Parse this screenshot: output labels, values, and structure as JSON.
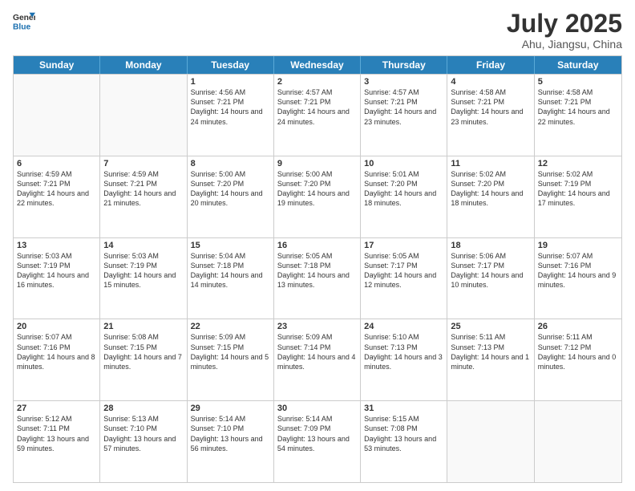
{
  "header": {
    "logo_line1": "General",
    "logo_line2": "Blue",
    "month_year": "July 2025",
    "location": "Ahu, Jiangsu, China"
  },
  "weekdays": [
    "Sunday",
    "Monday",
    "Tuesday",
    "Wednesday",
    "Thursday",
    "Friday",
    "Saturday"
  ],
  "weeks": [
    [
      {
        "day": "",
        "info": "",
        "empty": true
      },
      {
        "day": "",
        "info": "",
        "empty": true
      },
      {
        "day": "1",
        "info": "Sunrise: 4:56 AM\nSunset: 7:21 PM\nDaylight: 14 hours and 24 minutes."
      },
      {
        "day": "2",
        "info": "Sunrise: 4:57 AM\nSunset: 7:21 PM\nDaylight: 14 hours and 24 minutes."
      },
      {
        "day": "3",
        "info": "Sunrise: 4:57 AM\nSunset: 7:21 PM\nDaylight: 14 hours and 23 minutes."
      },
      {
        "day": "4",
        "info": "Sunrise: 4:58 AM\nSunset: 7:21 PM\nDaylight: 14 hours and 23 minutes."
      },
      {
        "day": "5",
        "info": "Sunrise: 4:58 AM\nSunset: 7:21 PM\nDaylight: 14 hours and 22 minutes."
      }
    ],
    [
      {
        "day": "6",
        "info": "Sunrise: 4:59 AM\nSunset: 7:21 PM\nDaylight: 14 hours and 22 minutes."
      },
      {
        "day": "7",
        "info": "Sunrise: 4:59 AM\nSunset: 7:21 PM\nDaylight: 14 hours and 21 minutes."
      },
      {
        "day": "8",
        "info": "Sunrise: 5:00 AM\nSunset: 7:20 PM\nDaylight: 14 hours and 20 minutes."
      },
      {
        "day": "9",
        "info": "Sunrise: 5:00 AM\nSunset: 7:20 PM\nDaylight: 14 hours and 19 minutes."
      },
      {
        "day": "10",
        "info": "Sunrise: 5:01 AM\nSunset: 7:20 PM\nDaylight: 14 hours and 18 minutes."
      },
      {
        "day": "11",
        "info": "Sunrise: 5:02 AM\nSunset: 7:20 PM\nDaylight: 14 hours and 18 minutes."
      },
      {
        "day": "12",
        "info": "Sunrise: 5:02 AM\nSunset: 7:19 PM\nDaylight: 14 hours and 17 minutes."
      }
    ],
    [
      {
        "day": "13",
        "info": "Sunrise: 5:03 AM\nSunset: 7:19 PM\nDaylight: 14 hours and 16 minutes."
      },
      {
        "day": "14",
        "info": "Sunrise: 5:03 AM\nSunset: 7:19 PM\nDaylight: 14 hours and 15 minutes."
      },
      {
        "day": "15",
        "info": "Sunrise: 5:04 AM\nSunset: 7:18 PM\nDaylight: 14 hours and 14 minutes."
      },
      {
        "day": "16",
        "info": "Sunrise: 5:05 AM\nSunset: 7:18 PM\nDaylight: 14 hours and 13 minutes."
      },
      {
        "day": "17",
        "info": "Sunrise: 5:05 AM\nSunset: 7:17 PM\nDaylight: 14 hours and 12 minutes."
      },
      {
        "day": "18",
        "info": "Sunrise: 5:06 AM\nSunset: 7:17 PM\nDaylight: 14 hours and 10 minutes."
      },
      {
        "day": "19",
        "info": "Sunrise: 5:07 AM\nSunset: 7:16 PM\nDaylight: 14 hours and 9 minutes."
      }
    ],
    [
      {
        "day": "20",
        "info": "Sunrise: 5:07 AM\nSunset: 7:16 PM\nDaylight: 14 hours and 8 minutes."
      },
      {
        "day": "21",
        "info": "Sunrise: 5:08 AM\nSunset: 7:15 PM\nDaylight: 14 hours and 7 minutes."
      },
      {
        "day": "22",
        "info": "Sunrise: 5:09 AM\nSunset: 7:15 PM\nDaylight: 14 hours and 5 minutes."
      },
      {
        "day": "23",
        "info": "Sunrise: 5:09 AM\nSunset: 7:14 PM\nDaylight: 14 hours and 4 minutes."
      },
      {
        "day": "24",
        "info": "Sunrise: 5:10 AM\nSunset: 7:13 PM\nDaylight: 14 hours and 3 minutes."
      },
      {
        "day": "25",
        "info": "Sunrise: 5:11 AM\nSunset: 7:13 PM\nDaylight: 14 hours and 1 minute."
      },
      {
        "day": "26",
        "info": "Sunrise: 5:11 AM\nSunset: 7:12 PM\nDaylight: 14 hours and 0 minutes."
      }
    ],
    [
      {
        "day": "27",
        "info": "Sunrise: 5:12 AM\nSunset: 7:11 PM\nDaylight: 13 hours and 59 minutes."
      },
      {
        "day": "28",
        "info": "Sunrise: 5:13 AM\nSunset: 7:10 PM\nDaylight: 13 hours and 57 minutes."
      },
      {
        "day": "29",
        "info": "Sunrise: 5:14 AM\nSunset: 7:10 PM\nDaylight: 13 hours and 56 minutes."
      },
      {
        "day": "30",
        "info": "Sunrise: 5:14 AM\nSunset: 7:09 PM\nDaylight: 13 hours and 54 minutes."
      },
      {
        "day": "31",
        "info": "Sunrise: 5:15 AM\nSunset: 7:08 PM\nDaylight: 13 hours and 53 minutes."
      },
      {
        "day": "",
        "info": "",
        "empty": true
      },
      {
        "day": "",
        "info": "",
        "empty": true
      }
    ]
  ]
}
